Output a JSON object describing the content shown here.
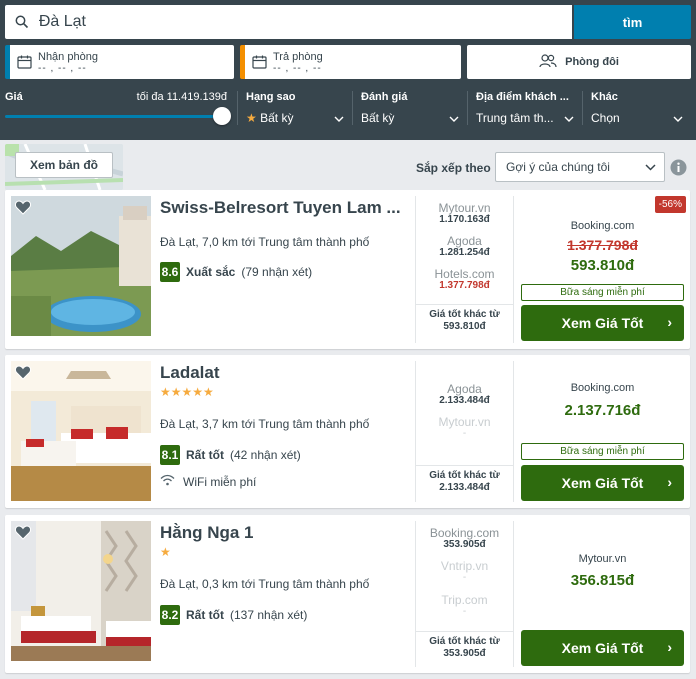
{
  "search": {
    "value": "Đà Lạt",
    "button": "tìm"
  },
  "dates": {
    "checkin_label": "Nhận phòng",
    "checkin_value": "-- , -- , --",
    "checkout_label": "Trả phòng",
    "checkout_value": "-- , -- , --",
    "room": "Phòng đôi"
  },
  "filters": {
    "price_label": "Giá",
    "price_max": "tối đa 11.419.139đ",
    "price_level": 1.0,
    "stars_label": "Hạng sao",
    "stars_value": "Bất kỳ",
    "rating_label": "Đánh giá",
    "rating_value": "Bất kỳ",
    "location_label": "Địa điểm khách ...",
    "location_value": "Trung tâm th...",
    "other_label": "Khác",
    "other_value": "Chọn"
  },
  "toolbar": {
    "map_button": "Xem bản đồ",
    "sort_label": "Sắp xếp theo",
    "sort_value": "Gợi ý của chúng tôi"
  },
  "hotels": [
    {
      "name": "Swiss-Belresort Tuyen Lam ...",
      "stars": "",
      "location": "Đà Lạt, 7,0 km tới Trung tâm thành phố",
      "score": "8.6",
      "score_text": "Xuất sắc",
      "reviews": "(79 nhận xét)",
      "amenity": "",
      "deals": [
        {
          "site": "Mytour.vn",
          "price": "1.170.163đ"
        },
        {
          "site": "Agoda",
          "price": "1.281.254đ"
        },
        {
          "site": "Hotels.com",
          "price": "1.377.798đ"
        }
      ],
      "best_label": "Giá tốt khác từ",
      "best_price": "593.810đ",
      "main_site": "Booking.com",
      "old_price": "1.377.798đ",
      "main_price": "593.810đ",
      "breakfast": "Bữa sáng miễn phí",
      "discount": "-56%",
      "cta": "Xem Giá Tốt"
    },
    {
      "name": "Ladalat",
      "stars": "★★★★★",
      "location": "Đà Lạt, 3,7 km tới Trung tâm thành phố",
      "score": "8.1",
      "score_text": "Rất tốt",
      "reviews": "(42 nhận xét)",
      "amenity": "WiFi miễn phí",
      "deals": [
        {
          "site": "Agoda",
          "price": "2.133.484đ"
        },
        {
          "site": "Mytour.vn",
          "price": "-"
        }
      ],
      "best_label": "Giá tốt khác từ",
      "best_price": "2.133.484đ",
      "main_site": "Booking.com",
      "main_price": "2.137.716đ",
      "breakfast": "Bữa sáng miễn phí",
      "cta": "Xem Giá Tốt"
    },
    {
      "name": "Hằng Nga 1",
      "stars": "★",
      "location": "Đà Lạt, 0,3 km tới Trung tâm thành phố",
      "score": "8.2",
      "score_text": "Rất tốt",
      "reviews": "(137 nhận xét)",
      "amenity": "",
      "deals": [
        {
          "site": "Booking.com",
          "price": "353.905đ"
        },
        {
          "site": "Vntrip.vn",
          "price": "-"
        },
        {
          "site": "Trip.com",
          "price": "-"
        }
      ],
      "best_label": "Giá tốt khác từ",
      "best_price": "353.905đ",
      "main_site": "Mytour.vn",
      "main_price": "356.815đ",
      "cta": "Xem Giá Tốt"
    }
  ],
  "colors": {
    "header": "#37454d",
    "accent": "#007faf",
    "green": "#2e6b0e",
    "red": "#c2372d",
    "star": "#f6ab3f"
  }
}
